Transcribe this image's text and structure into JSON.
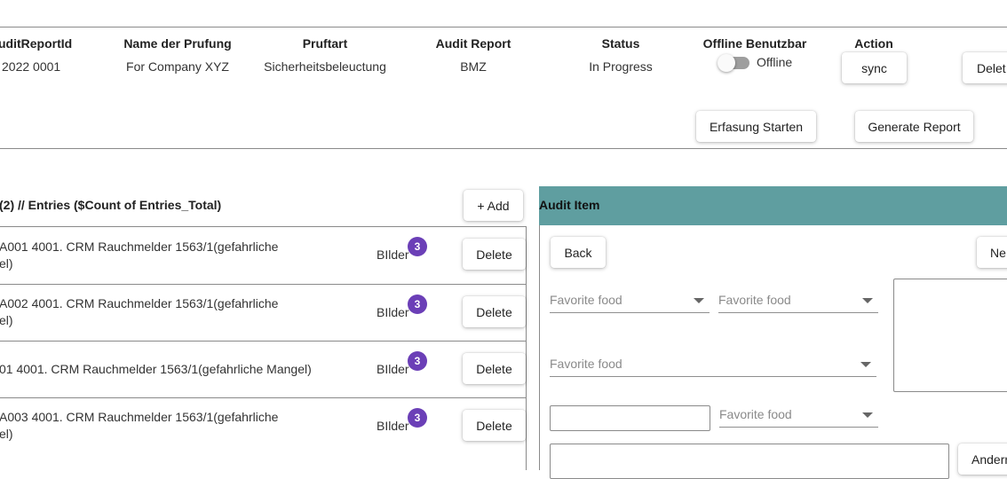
{
  "header": {
    "columns": [
      "uditReportId",
      "Name der Prufung",
      "Pruftart",
      "Audit Report",
      "Status",
      "Offline Benutzbar",
      "Action"
    ],
    "row": {
      "id": "2022 0001",
      "name": "For Company XYZ",
      "pruftart": "Sicherheitsbeleuctung",
      "audit_report": "BMZ",
      "status": "In Progress",
      "offline_label": "Offline",
      "offline_enabled": false,
      "sync_label": "sync",
      "delete_label": "Delet"
    },
    "erfassung_label": "Erfasung Starten",
    "generate_label": "Generate Report"
  },
  "entries": {
    "title": "(2) // Entries ($Count of Entries_Total)",
    "add_label": "+ Add",
    "items": [
      {
        "line1": "A001 4001. CRM Rauchmelder 1563/1(gefahrliche",
        "line2": "el)",
        "bilder": "BIlder",
        "count": "3",
        "delete": "Delete"
      },
      {
        "line1": "A002 4001. CRM Rauchmelder 1563/1(gefahrliche",
        "line2": "el)",
        "bilder": "BIlder",
        "count": "3",
        "delete": "Delete"
      },
      {
        "line1": "01 4001. CRM Rauchmelder 1563/1(gefahrliche Mangel)",
        "line2": "",
        "bilder": "BIlder",
        "count": "3",
        "delete": "Delete"
      },
      {
        "line1": "A003 4001. CRM Rauchmelder 1563/1(gefahrliche",
        "line2": "el)",
        "bilder": "BIlder",
        "count": "3",
        "delete": "Delete"
      }
    ]
  },
  "audit_item": {
    "title": "Audit Item",
    "header_color": "#5f9ea0",
    "back_label": "Back",
    "next_label": "Ne",
    "select_placeholder": "Favorite food",
    "aendern_label": "Anderr"
  },
  "colors": {
    "badge": "#6b3fb7",
    "divider": "#8a8a8a"
  }
}
